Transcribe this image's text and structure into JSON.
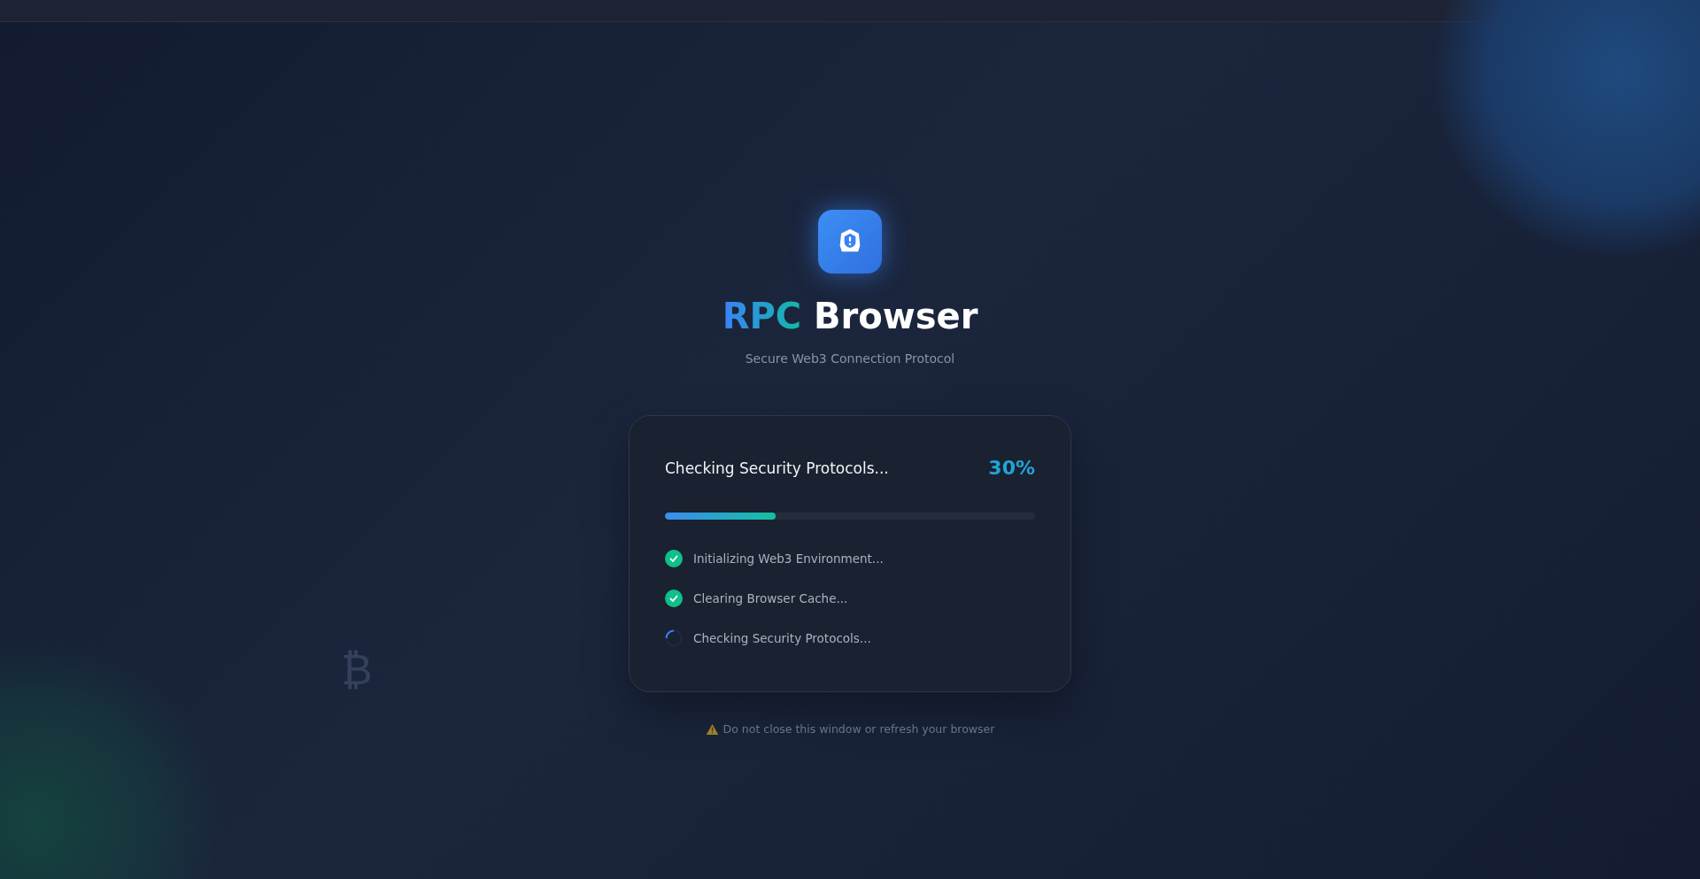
{
  "brand": {
    "accent": "RPC",
    "rest": "Browser",
    "subtitle": "Secure Web3 Connection Protocol"
  },
  "progress": {
    "title": "Checking Security Protocols...",
    "percent": "30%",
    "level": 0.3
  },
  "steps": [
    {
      "label": "Initializing Web3 Environment...",
      "kind": "done"
    },
    {
      "label": "Clearing Browser Cache...",
      "kind": "done"
    },
    {
      "label": "Checking Security Protocols...",
      "kind": "loading"
    }
  ],
  "warning": "Do not close this window or refresh your browser",
  "decor_symbol": "₿"
}
